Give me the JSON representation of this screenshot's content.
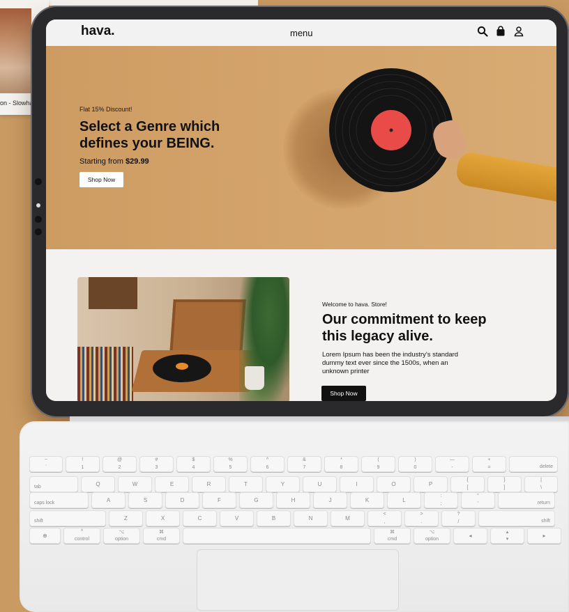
{
  "background": {
    "caption": "on - Slowha"
  },
  "nav": {
    "logo": "hava.",
    "menu": "menu",
    "icons": [
      "search-icon",
      "shopping-bag-icon",
      "user-icon"
    ]
  },
  "hero": {
    "discount": "Flat 15% Discount!",
    "headline": "Select a Genre which defines your BEING.",
    "price_prefix": "Starting from ",
    "price": "$29.99",
    "cta": "Shop Now"
  },
  "about": {
    "welcome": "Welcome to hava. Store!",
    "headline": "Our commitment to keep this legacy alive.",
    "body": "Lorem Ipsum has been the industry's standard dummy text ever since the 1500s, when an unknown printer",
    "cta": "Shop Now"
  },
  "keyboard": {
    "rows": [
      [
        {
          "t": "~",
          "b": "`"
        },
        {
          "t": "!",
          "b": "1"
        },
        {
          "t": "@",
          "b": "2"
        },
        {
          "t": "#",
          "b": "3"
        },
        {
          "t": "$",
          "b": "4"
        },
        {
          "t": "%",
          "b": "5"
        },
        {
          "t": "^",
          "b": "6"
        },
        {
          "t": "&",
          "b": "7"
        },
        {
          "t": "*",
          "b": "8"
        },
        {
          "t": "(",
          "b": "9"
        },
        {
          "t": ")",
          "b": "0"
        },
        {
          "t": "—",
          "b": "-"
        },
        {
          "t": "+",
          "b": "="
        },
        {
          "l": "delete"
        }
      ],
      [
        {
          "l": "tab"
        },
        {
          "c": "Q"
        },
        {
          "c": "W"
        },
        {
          "c": "E"
        },
        {
          "c": "R"
        },
        {
          "c": "T"
        },
        {
          "c": "Y"
        },
        {
          "c": "U"
        },
        {
          "c": "I"
        },
        {
          "c": "O"
        },
        {
          "c": "P"
        },
        {
          "t": "{",
          "b": "["
        },
        {
          "t": "}",
          "b": "]"
        },
        {
          "t": "|",
          "b": "\\"
        }
      ],
      [
        {
          "l": "caps lock"
        },
        {
          "c": "A"
        },
        {
          "c": "S"
        },
        {
          "c": "D"
        },
        {
          "c": "F"
        },
        {
          "c": "G"
        },
        {
          "c": "H"
        },
        {
          "c": "J"
        },
        {
          "c": "K"
        },
        {
          "c": "L"
        },
        {
          "t": ":",
          "b": ";"
        },
        {
          "t": "\"",
          "b": "'"
        },
        {
          "l": "return"
        }
      ],
      [
        {
          "l": "shift"
        },
        {
          "c": "Z"
        },
        {
          "c": "X"
        },
        {
          "c": "C"
        },
        {
          "c": "V"
        },
        {
          "c": "B"
        },
        {
          "c": "N"
        },
        {
          "c": "M"
        },
        {
          "t": "<",
          "b": ","
        },
        {
          "t": ">",
          "b": "."
        },
        {
          "t": "?",
          "b": "/"
        },
        {
          "l": "shift"
        }
      ],
      [
        {
          "c": "⊕"
        },
        {
          "t": "^",
          "b": "control"
        },
        {
          "t": "⌥",
          "b": "option"
        },
        {
          "t": "⌘",
          "b": "cmd"
        },
        {
          "c": ""
        },
        {
          "t": "⌘",
          "b": "cmd"
        },
        {
          "t": "⌥",
          "b": "option"
        },
        {
          "c": "◂"
        },
        {
          "t": "▴",
          "b": "▾"
        },
        {
          "c": "▸"
        }
      ]
    ]
  }
}
